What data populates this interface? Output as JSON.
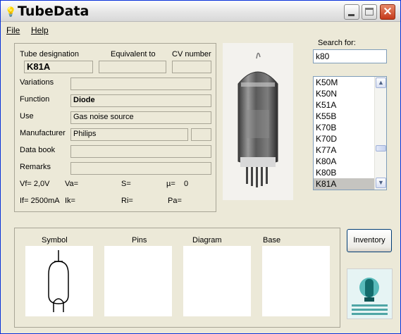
{
  "window": {
    "title": "TubeData"
  },
  "menu": {
    "file": "File",
    "help": "Help"
  },
  "tube": {
    "designation_label": "Tube designation",
    "equivalent_label": "Equivalent to",
    "cv_label": "CV number",
    "designation": "K81A",
    "equivalent": "",
    "cv": "",
    "variations_label": "Variations",
    "variations": "",
    "function_label": "Function",
    "function": "Diode",
    "use_label": "Use",
    "use": "Gas noise source",
    "manufacturer_label": "Manufacturer",
    "manufacturer": "Philips",
    "manufacturer_extra": "",
    "databook_label": "Data book",
    "databook": "",
    "remarks_label": "Remarks",
    "remarks": ""
  },
  "params": {
    "vf": "Vf= 2,0V",
    "va": "Va=",
    "s": "S=",
    "mu": "µ=",
    "mu_value": "0",
    "if": "If= 2500mA",
    "ik": "Ik=",
    "ri": "Ri=",
    "pa": "Pa="
  },
  "search": {
    "label": "Search for:",
    "value": "k80"
  },
  "list": {
    "items": [
      "K50M",
      "K50N",
      "K51A",
      "K55B",
      "K70B",
      "K70D",
      "K77A",
      "K80A",
      "K80B",
      "K81A"
    ],
    "selected": "K81A"
  },
  "panels": {
    "symbol": "Symbol",
    "pins": "Pins",
    "diagram": "Diagram",
    "base": "Base"
  },
  "buttons": {
    "inventory": "Inventory"
  },
  "icons": {
    "app": "lightbulb-icon",
    "minimize": "minimize-icon",
    "maximize": "maximize-icon",
    "close": "close-icon",
    "scroll_up": "chevron-up-icon",
    "scroll_down": "chevron-down-icon"
  },
  "colors": {
    "selection": "#c5c4c0",
    "close_button": "#c5391a",
    "title_bar_border": "#0831d9"
  }
}
